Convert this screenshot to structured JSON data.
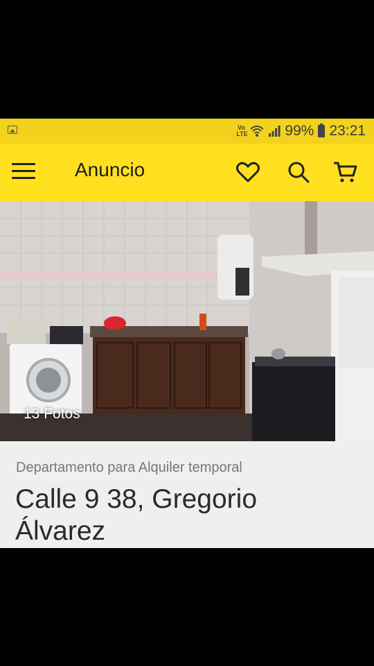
{
  "status_bar": {
    "volte": "Vo LTE",
    "battery_percent": "99%",
    "time": "23:21"
  },
  "app_bar": {
    "title": "Anuncio",
    "icons": [
      "menu-icon",
      "heart-icon",
      "search-icon",
      "cart-icon"
    ]
  },
  "listing": {
    "photo_count_label": "13 Fotos",
    "property_type": "Departamento para Alquiler temporal",
    "address": "Calle 9 38, Gregorio Álvarez"
  },
  "colors": {
    "status_bar": "#f2d21c",
    "app_bar": "#fee01f",
    "info_bg": "#efefef"
  }
}
